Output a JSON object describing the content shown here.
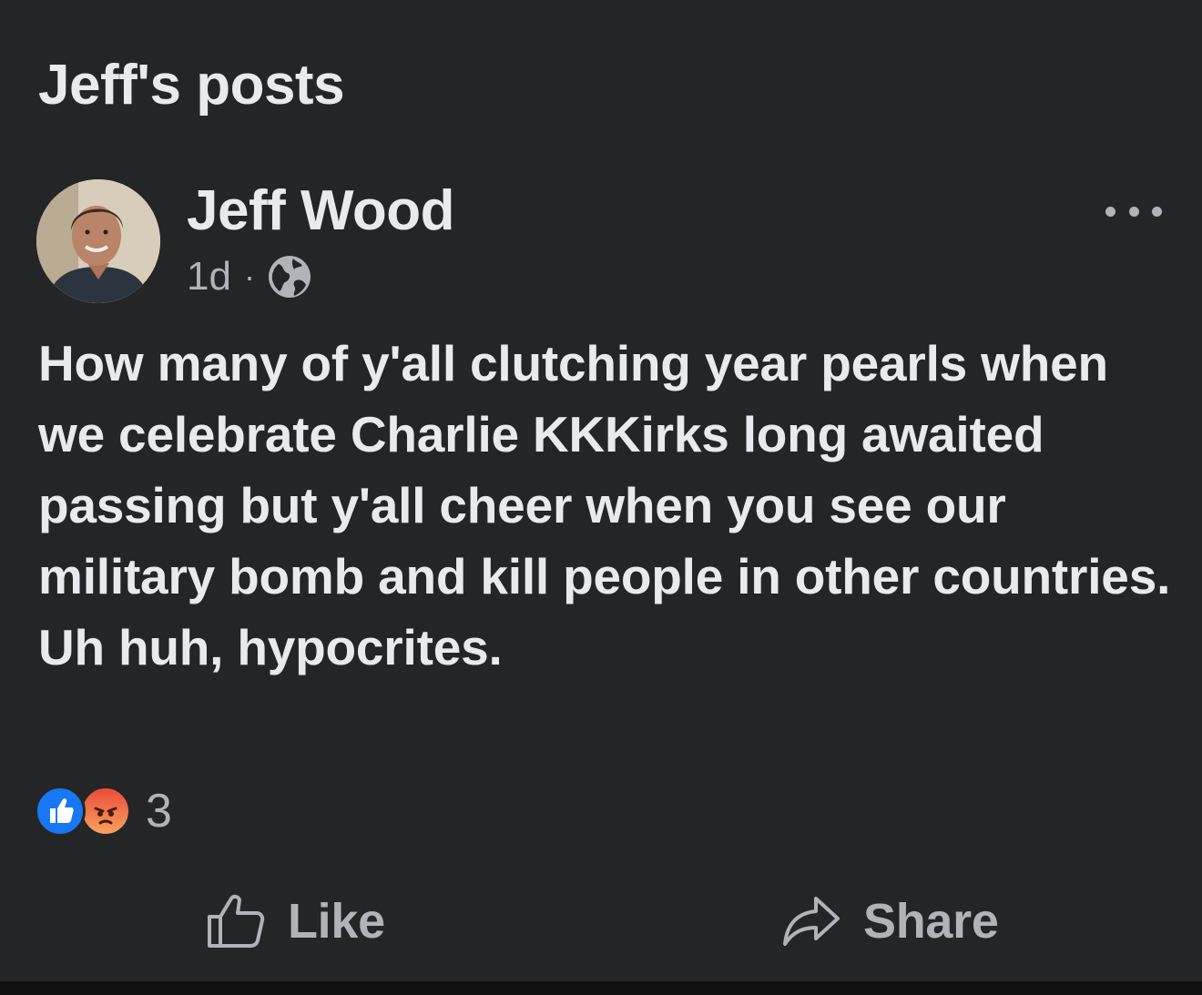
{
  "header": {
    "title": "Jeff's posts"
  },
  "post": {
    "author": "Jeff Wood",
    "time": "1d",
    "separator": "·",
    "audience_icon": "globe-icon",
    "menu_icon": "more-options-icon",
    "text": "How many of y'all clutching year pearls when we celebrate Charlie KKKirks long awaited passing but y'all cheer when you see our military bomb and kill people in other countries. Uh huh, hypocrites.",
    "reactions": {
      "types": [
        "like",
        "angry"
      ],
      "count": "3"
    },
    "actions": {
      "like_label": "Like",
      "share_label": "Share"
    }
  },
  "colors": {
    "background": "#242526",
    "primary_text": "#e9eaee",
    "secondary_text": "#b0b3b8",
    "like_blue": "#1877f2",
    "angry_orange": "#f0703f"
  }
}
